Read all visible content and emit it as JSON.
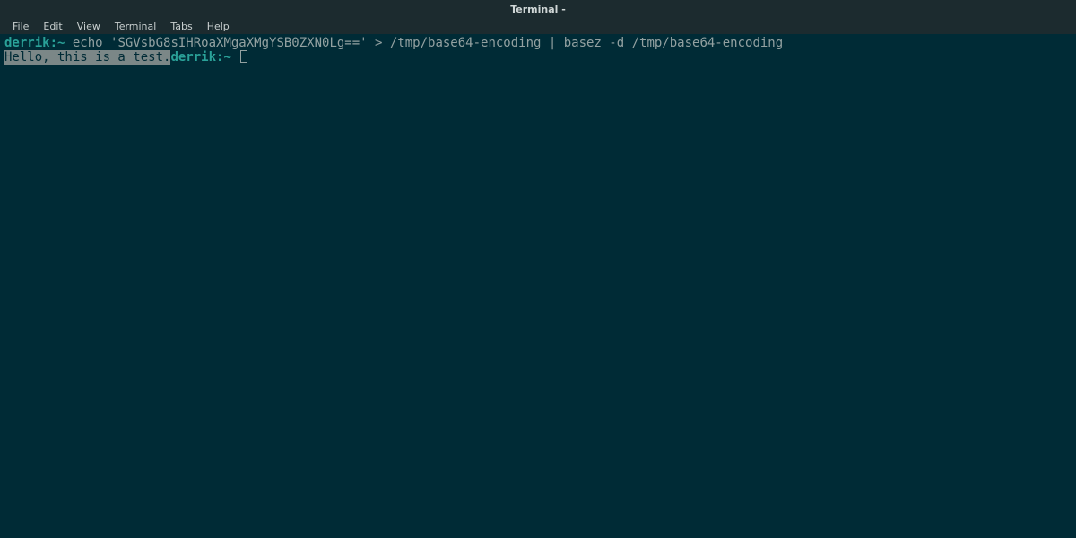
{
  "window": {
    "title": "Terminal -"
  },
  "menubar": {
    "items": [
      "File",
      "Edit",
      "View",
      "Terminal",
      "Tabs",
      "Help"
    ]
  },
  "terminal": {
    "line1": {
      "prompt": "derrik:~",
      "command": " echo 'SGVsbG8sIHRoaXMgaXMgYSB0ZXN0Lg==' > /tmp/base64-encoding | basez -d /tmp/base64-encoding"
    },
    "line2": {
      "output_highlight": "Hello, this is a test.",
      "prompt": "derrik:~",
      "after": " "
    }
  }
}
